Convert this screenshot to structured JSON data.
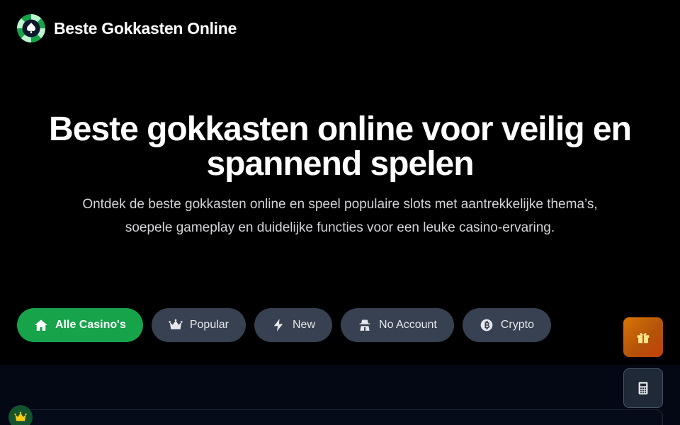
{
  "header": {
    "logo_icon": "spade-chip-logo",
    "title": "Beste Gokkasten Online"
  },
  "hero": {
    "title": "Beste gokkasten online voor veilig en spannend spelen",
    "description": "Ontdek de beste gokkasten online en speel populaire slots met aantrekkelijke thema’s, soepele gameplay en duidelijke functies voor een leuke casino-ervaring."
  },
  "filters": [
    {
      "label": "Alle Casino's",
      "icon": "home-icon",
      "active": true
    },
    {
      "label": "Popular",
      "icon": "crown-icon",
      "active": false
    },
    {
      "label": "New",
      "icon": "lightning-icon",
      "active": false
    },
    {
      "label": "No Account",
      "icon": "incognito-icon",
      "active": false
    },
    {
      "label": "Crypto",
      "icon": "bitcoin-icon",
      "active": false
    }
  ],
  "floating_actions": [
    {
      "icon": "gift-icon"
    },
    {
      "icon": "calculator-icon"
    }
  ],
  "colors": {
    "background": "#000000",
    "accent_green": "#16a34a",
    "chip_gray": "#374151",
    "gift_orange": "#d97706"
  }
}
